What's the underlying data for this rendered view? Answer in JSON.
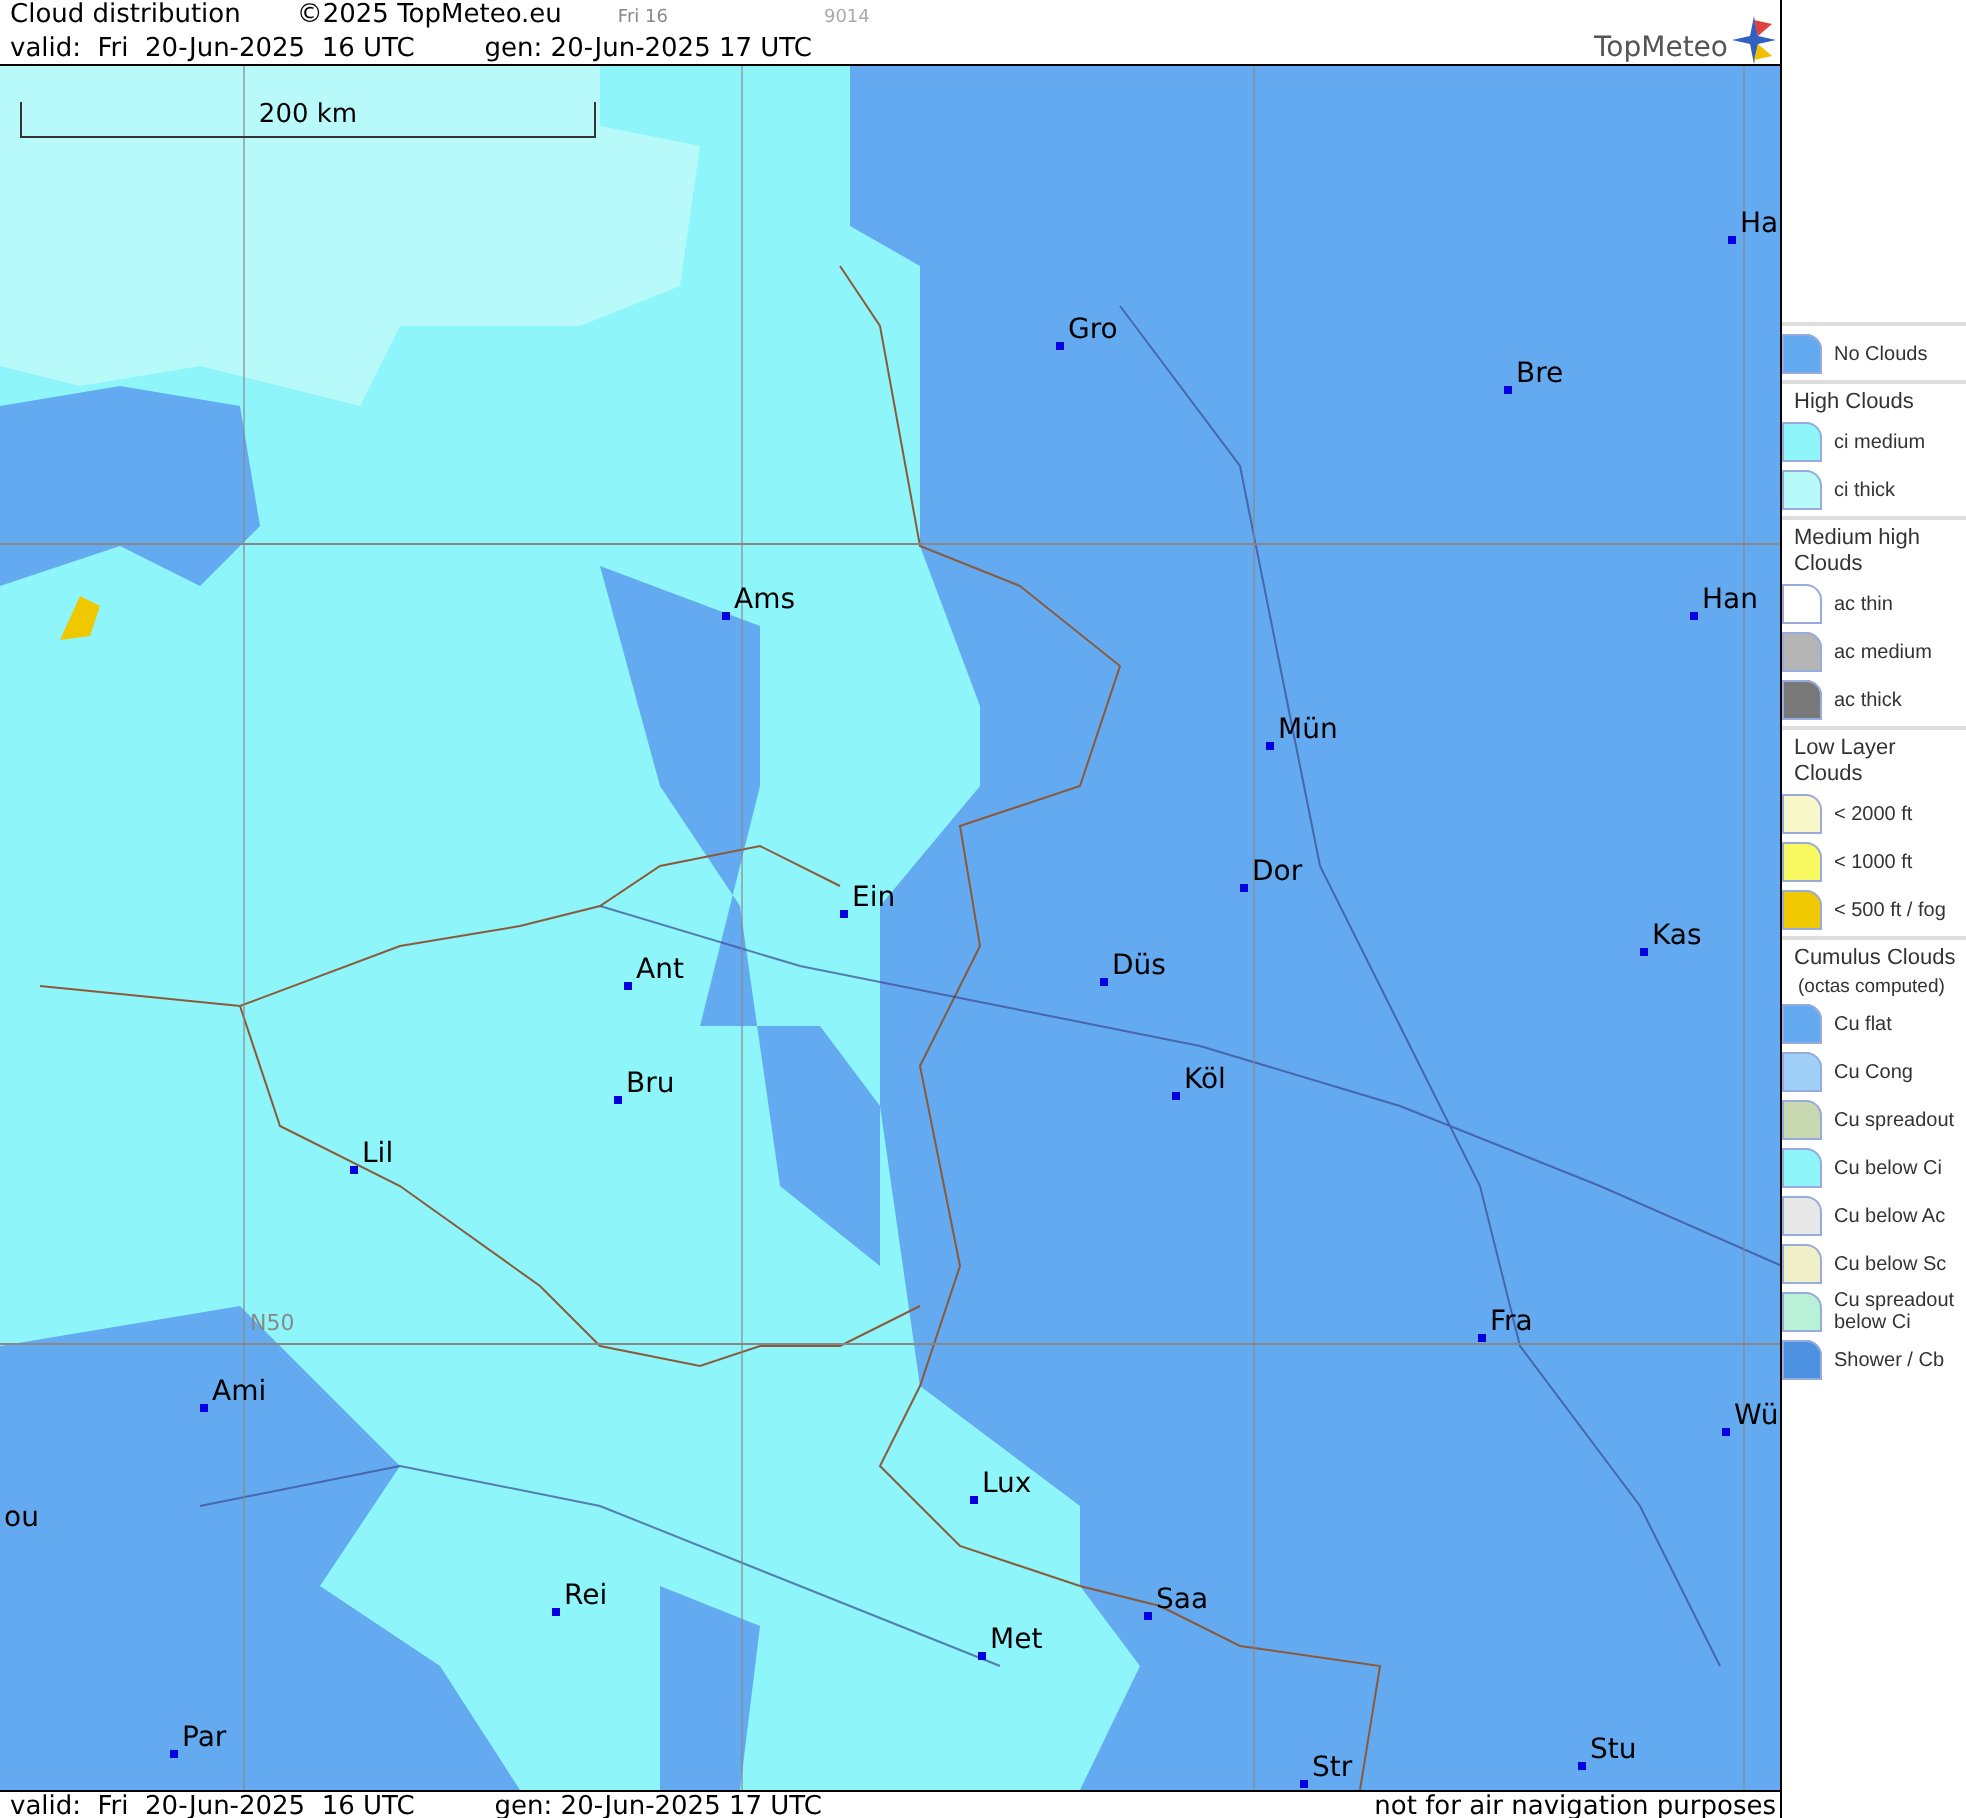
{
  "header": {
    "title": "Cloud distribution",
    "copyright": "©2025 TopMeteo.eu",
    "day": "Fri 16",
    "code": "9014",
    "valid": "valid:  Fri  20-Jun-2025  16 UTC",
    "generated": "gen: 20-Jun-2025 17 UTC",
    "logo": "TopMeteo"
  },
  "map": {
    "scale": "200 km",
    "latitude_label": "N50",
    "cities": [
      {
        "name": "Gro"
      },
      {
        "name": "Bre"
      },
      {
        "name": "Ha"
      },
      {
        "name": "Ams"
      },
      {
        "name": "Han"
      },
      {
        "name": "Mün"
      },
      {
        "name": "Ein"
      },
      {
        "name": "Dor"
      },
      {
        "name": "Kas"
      },
      {
        "name": "Düs"
      },
      {
        "name": "Ant"
      },
      {
        "name": "Köl"
      },
      {
        "name": "Bru"
      },
      {
        "name": "Lil"
      },
      {
        "name": "Fra"
      },
      {
        "name": "Ami"
      },
      {
        "name": "Wü"
      },
      {
        "name": "Lux"
      },
      {
        "name": "ou"
      },
      {
        "name": "Rei"
      },
      {
        "name": "Saa"
      },
      {
        "name": "Met"
      },
      {
        "name": "Par"
      },
      {
        "name": "Stu"
      },
      {
        "name": "Str"
      }
    ]
  },
  "legend": [
    {
      "items": [
        {
          "label": "No Clouds",
          "color": "#64aaf0"
        }
      ]
    },
    {
      "heading": "High Clouds",
      "items": [
        {
          "label": "ci medium",
          "color": "#8ef6fa"
        },
        {
          "label": "ci thick",
          "color": "#b8fafa"
        }
      ]
    },
    {
      "heading": "Medium high Clouds",
      "items": [
        {
          "label": "ac thin",
          "color": "#ffffff"
        },
        {
          "label": "ac medium",
          "color": "#b4b4b4"
        },
        {
          "label": "ac thick",
          "color": "#787878"
        }
      ]
    },
    {
      "heading": "Low Layer Clouds",
      "items": [
        {
          "label": "< 2000 ft",
          "color": "#f8f8c8"
        },
        {
          "label": "< 1000 ft",
          "color": "#f8f860"
        },
        {
          "label": "< 500 ft / fog",
          "color": "#f0c800"
        }
      ]
    },
    {
      "heading": "Cumulus Clouds",
      "subheading": "(octas computed)",
      "items": [
        {
          "label": "Cu flat",
          "color": "#64aaf0"
        },
        {
          "label": "Cu Cong",
          "color": "#a0d0f8"
        },
        {
          "label": "Cu spreadout",
          "color": "#c8d8b0"
        },
        {
          "label": "Cu below Ci",
          "color": "#8ef6fa"
        },
        {
          "label": "Cu below Ac",
          "color": "#e8e8e8"
        },
        {
          "label": "Cu below Sc",
          "color": "#f0f0c8"
        },
        {
          "label": "Cu spreadout below Ci",
          "color": "#b8f0d8"
        },
        {
          "label": "Shower / Cb",
          "color": "#4c90e0"
        }
      ]
    }
  ],
  "footer": {
    "valid": "valid:  Fri  20-Jun-2025  16 UTC",
    "generated": "gen: 20-Jun-2025 17 UTC",
    "note": "not for air navigation purposes"
  }
}
